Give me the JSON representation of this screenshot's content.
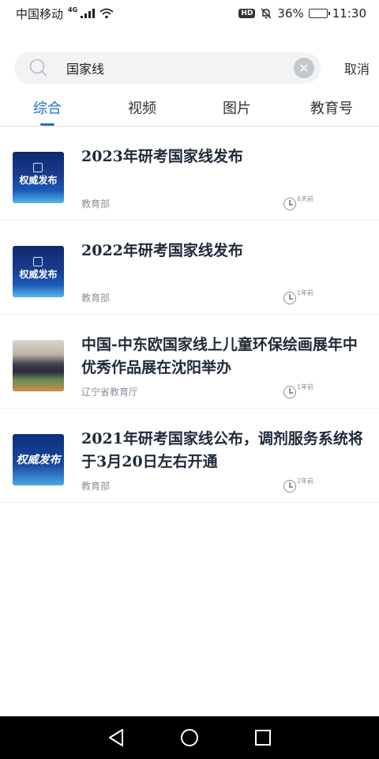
{
  "status_bar": {
    "carrier": "中国移动",
    "network": "4G",
    "hd": "HD",
    "battery": "36%",
    "battery_level": 0.36,
    "time": "11:30"
  },
  "search": {
    "query": "国家线",
    "cancel_label": "取消"
  },
  "tabs": [
    {
      "label": "综合",
      "active": true
    },
    {
      "label": "视频",
      "active": false
    },
    {
      "label": "图片",
      "active": false
    },
    {
      "label": "教育号",
      "active": false
    }
  ],
  "news": [
    {
      "title": "2023年研考国家线发布",
      "source": "教育部",
      "time": "6天前",
      "thumb_text": "权威发布"
    },
    {
      "title": "2022年研考国家线发布",
      "source": "教育部",
      "time": "1年前",
      "thumb_text": "权威发布"
    },
    {
      "title": "中国-中东欧国家线上儿童环保绘画展年中优秀作品展在沈阳举办",
      "source": "辽宁省教育厅",
      "time": "1年前",
      "thumb_text": ""
    },
    {
      "title": "2021年研考国家线公布，调剂服务系统将于3月20日左右开通",
      "source": "教育部",
      "time": "2年前",
      "thumb_text": "权威发布"
    }
  ]
}
